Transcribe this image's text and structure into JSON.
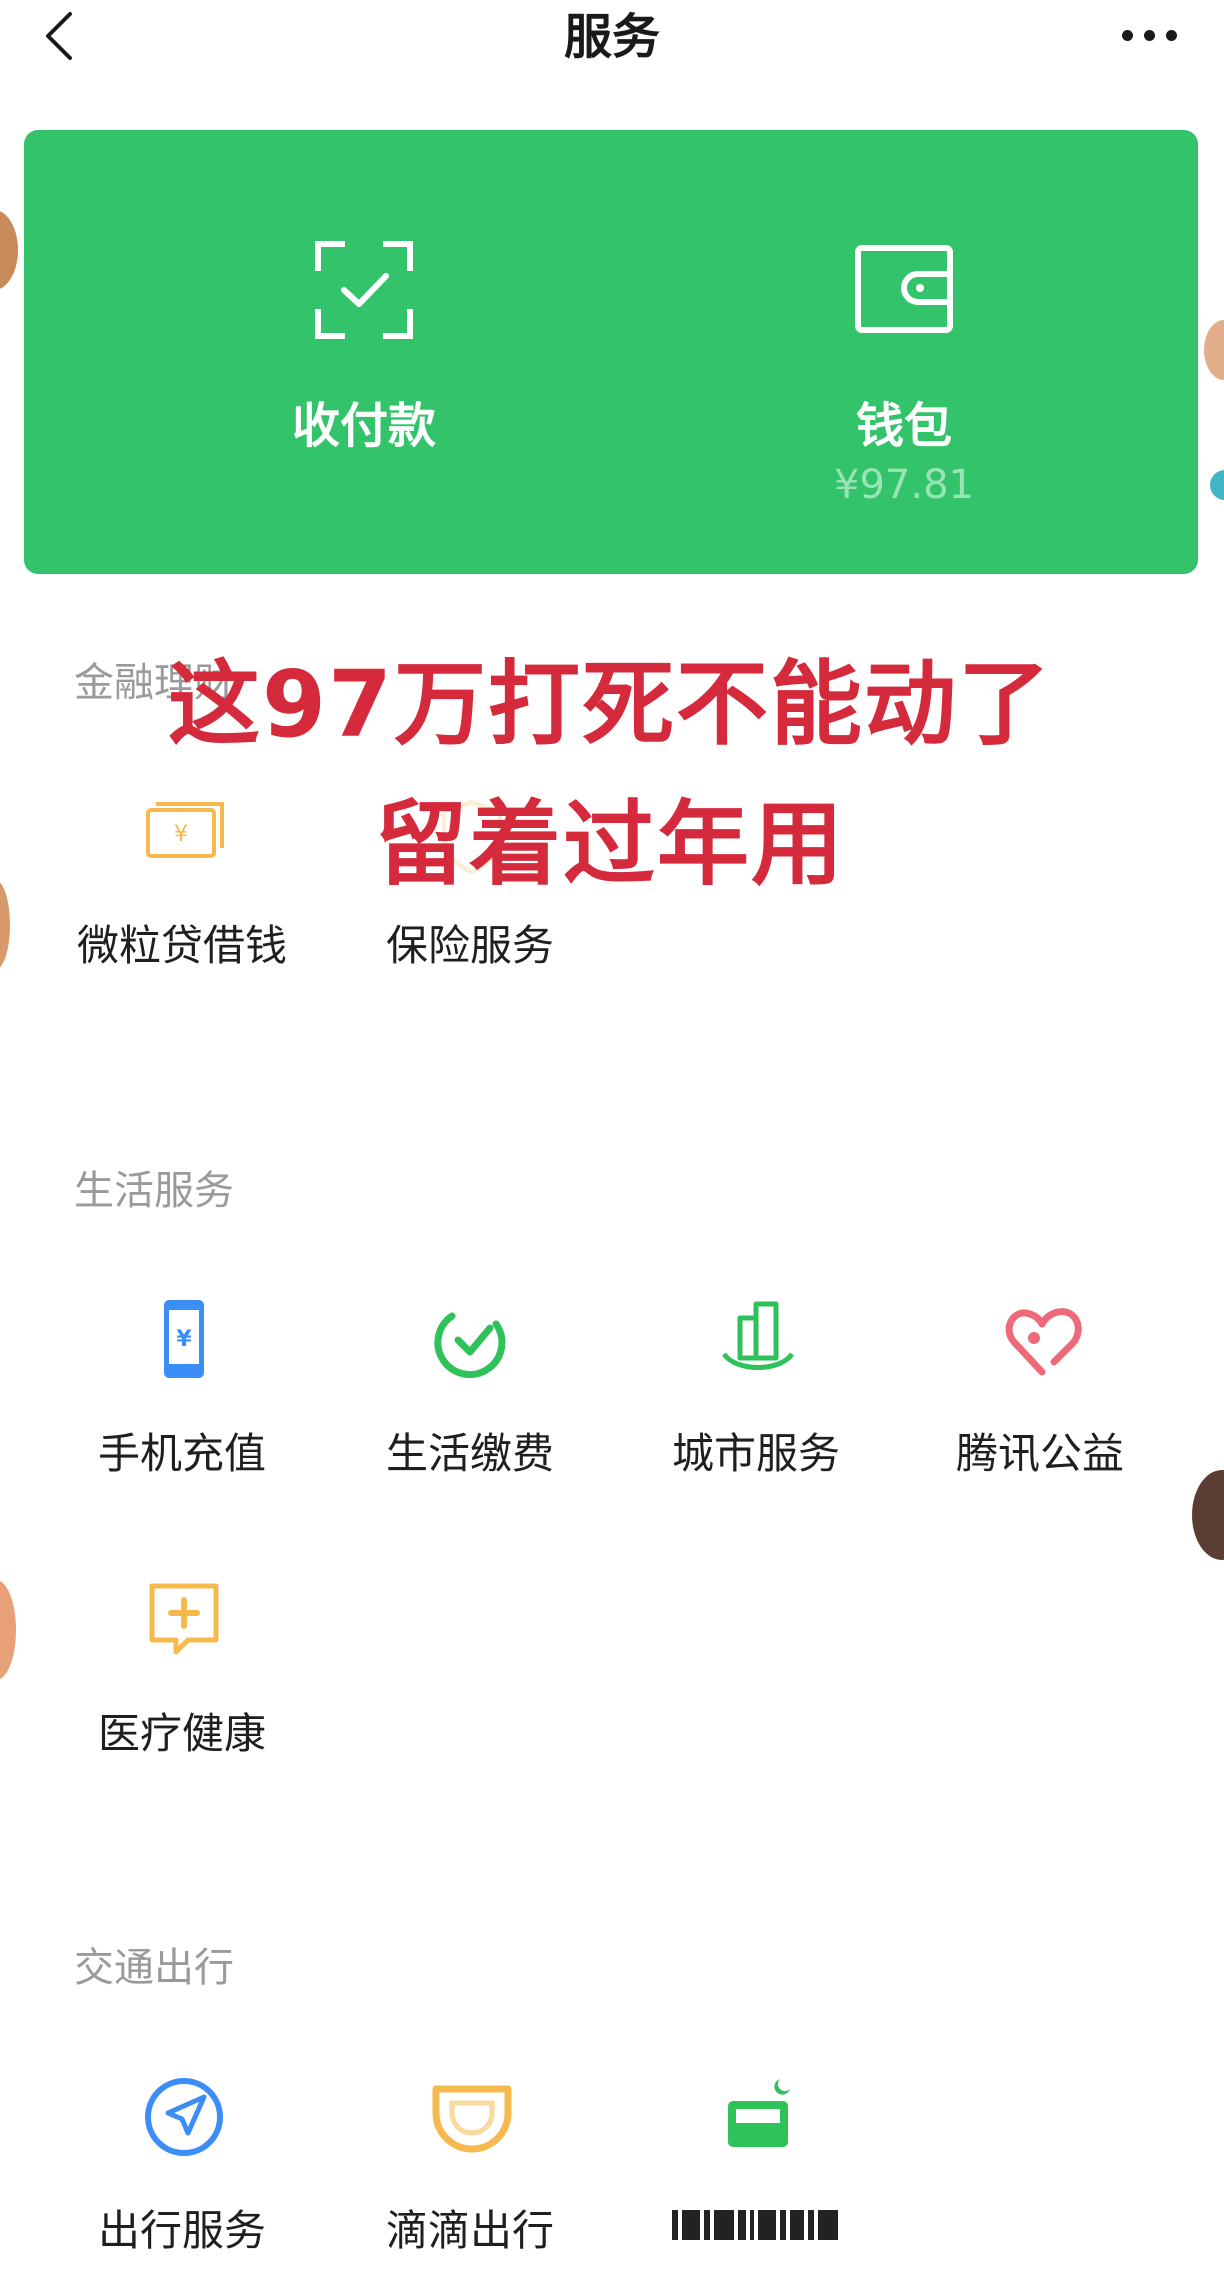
{
  "nav": {
    "title": "服务"
  },
  "card": {
    "pay_label": "收付款",
    "wallet_label": "钱包",
    "wallet_balance": "¥97.81"
  },
  "overlay": {
    "line1": "这97万打死不能动了",
    "line2": "留着过年用"
  },
  "sections": {
    "finance": {
      "title": "金融理财",
      "items": [
        {
          "label": "微粒贷借钱",
          "icon": "money-stack-icon"
        },
        {
          "label": "保险服务",
          "icon": "insurance-icon"
        }
      ]
    },
    "life": {
      "title": "生活服务",
      "items": [
        {
          "label": "手机充值",
          "icon": "phone-topup-icon"
        },
        {
          "label": "生活缴费",
          "icon": "utility-payment-icon"
        },
        {
          "label": "城市服务",
          "icon": "city-building-icon"
        },
        {
          "label": "腾讯公益",
          "icon": "charity-heart-icon"
        },
        {
          "label": "医疗健康",
          "icon": "medical-plus-icon"
        }
      ]
    },
    "transport": {
      "title": "交通出行",
      "items": [
        {
          "label": "出行服务",
          "icon": "navigation-arrow-icon"
        },
        {
          "label": "滴滴出行",
          "icon": "didi-icon"
        },
        {
          "label": "",
          "icon": "hotel-bed-icon"
        }
      ]
    }
  },
  "colors": {
    "card_green": "#33c36a",
    "overlay_red": "#d52a3c",
    "section_gray": "#9a9a9a",
    "icon_blue": "#3a8ef6",
    "icon_green": "#2fc25b",
    "icon_pink": "#ec6a7a",
    "icon_orange": "#f5b94e"
  }
}
